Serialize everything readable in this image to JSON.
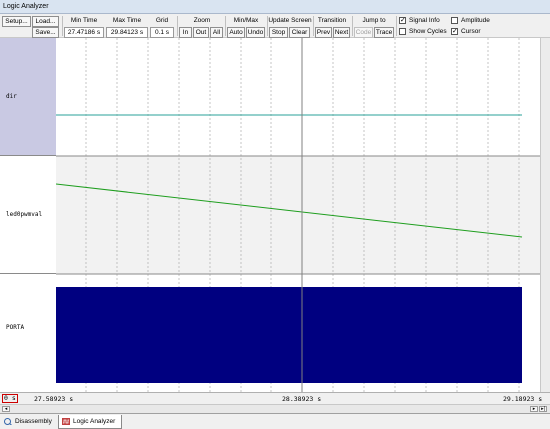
{
  "window": {
    "title": "Logic Analyzer"
  },
  "toolbar": {
    "setup_label": "Setup...",
    "load_label": "Load...",
    "save_label": "Save...",
    "min_time_label": "Min Time",
    "min_time_value": "27.47186 s",
    "max_time_label": "Max Time",
    "max_time_value": "29.84123 s",
    "grid_label": "Grid",
    "grid_value": "0.1 s",
    "zoom_label": "Zoom",
    "zoom_in": "In",
    "zoom_out": "Out",
    "zoom_all": "All",
    "minmax_label": "Min/Max",
    "minmax_auto": "Auto",
    "minmax_undo": "Undo",
    "update_label": "Update Screen",
    "update_stop": "Stop",
    "update_clear": "Clear",
    "transition_label": "Transition",
    "transition_prev": "Prev",
    "transition_next": "Next",
    "jump_label": "Jump to",
    "jump_code": "Code",
    "jump_trace": "Trace",
    "signal_info_label": "Signal Info",
    "signal_info_checked": true,
    "amplitude_label": "Amplitude",
    "amplitude_checked": false,
    "show_cycles_label": "Show Cycles",
    "show_cycles_checked": false,
    "cursor_label": "Cursor",
    "cursor_checked": true,
    "check_mark": "✓"
  },
  "signals": [
    {
      "name": "dir",
      "max": "3",
      "min": "0"
    },
    {
      "name": "led0pwmval",
      "max": "310",
      "min": "0"
    },
    {
      "name": "PORTA",
      "max": "1",
      "min": "0"
    }
  ],
  "timeline": {
    "left_time": "27.58923 s",
    "cursor_time": "28.38923 s",
    "right_time": "29.18923 s",
    "corner_value": "0 s"
  },
  "tabs": [
    {
      "label": "Disassembly",
      "active": false
    },
    {
      "label": "Logic Analyzer",
      "active": true
    }
  ],
  "colors": {
    "dir_line": "#2aa198",
    "pwm_line": "#1e9e1e",
    "porta_fill": "#000080",
    "cursor": "#808080"
  }
}
